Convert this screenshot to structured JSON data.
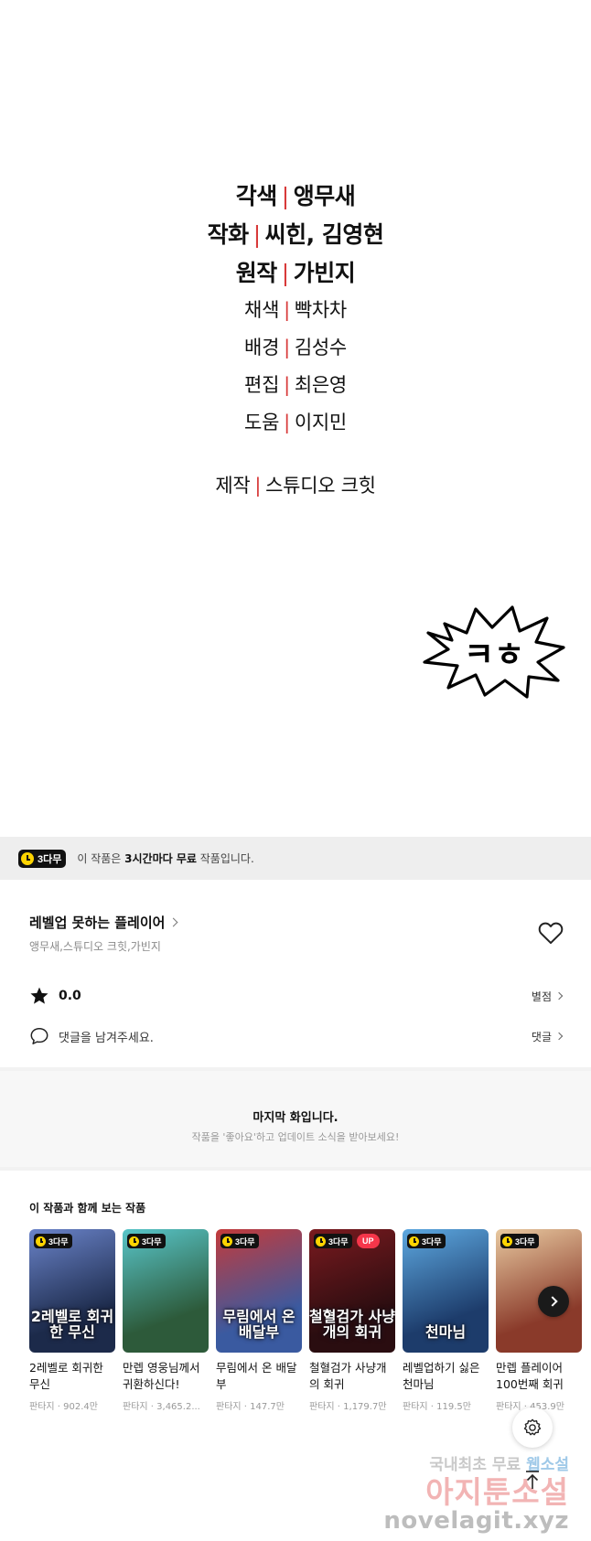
{
  "credits": {
    "lines": [
      {
        "role": "각색",
        "names": "앵무새"
      },
      {
        "role": "작화",
        "names": "씨힌, 김영현"
      },
      {
        "role": "원작",
        "names": "가빈지"
      },
      {
        "role": "채색",
        "names": "빡차차"
      },
      {
        "role": "배경",
        "names": "김성수"
      },
      {
        "role": "편집",
        "names": "최은영"
      },
      {
        "role": "도움",
        "names": "이지민"
      },
      {
        "role": "제작",
        "names": "스튜디오 크힛"
      }
    ],
    "separator": "|",
    "sfx_text": "ㅋㅎ"
  },
  "free_banner": {
    "badge": "3다무",
    "text_prefix": "이 작품은 ",
    "text_bold": "3시간마다 무료",
    "text_suffix": " 작품입니다."
  },
  "work": {
    "title": "레벨업 못하는 플레이어",
    "authors": "앵무새,스튜디오 크힛,가빈지",
    "rating": "0.0",
    "rating_link": "별점",
    "comment_prompt": "댓글을 남겨주세요.",
    "comment_link": "댓글"
  },
  "last_episode": {
    "title": "마지막 화입니다.",
    "subtitle": "작품을 '좋아요'하고 업데이트 소식을 받아보세요!"
  },
  "recommendations": {
    "heading": "이 작품과 함께 보는 작품",
    "items": [
      {
        "title": "2레벨로 회귀한 무신",
        "cover_text": "2레벨로 회귀한 무신",
        "genre": "판타지",
        "views": "902.4만",
        "badge": "3다무",
        "up": "",
        "colors": [
          "#1c2a4a",
          "#6a83c9"
        ]
      },
      {
        "title": "만렙 영웅님께서 귀환하신다!",
        "cover_text": "",
        "genre": "판타지",
        "views": "3,465.2...",
        "badge": "3다무",
        "up": "",
        "colors": [
          "#2d5a3a",
          "#58c5c9"
        ]
      },
      {
        "title": "무림에서 온 배달부",
        "cover_text": "무림에서 온 배달부",
        "genre": "판타지",
        "views": "147.7만",
        "badge": "3다무",
        "up": "",
        "colors": [
          "#3a5aa0",
          "#c43a3a"
        ]
      },
      {
        "title": "철혈검가 사냥개의 회귀",
        "cover_text": "철혈검가 사냥개의 회귀",
        "genre": "판타지",
        "views": "1,179.7만",
        "badge": "3다무",
        "up": "UP",
        "colors": [
          "#2a0d10",
          "#7a1a1f"
        ]
      },
      {
        "title": "레벨업하기 싫은 천마님",
        "cover_text": "천마님",
        "genre": "판타지",
        "views": "119.5만",
        "badge": "3다무",
        "up": "",
        "colors": [
          "#1d3c6b",
          "#5da8e0"
        ]
      },
      {
        "title": "만렙 플레이어 100번째 회귀",
        "cover_text": "",
        "genre": "판타지",
        "views": "453.9만",
        "badge": "3다무",
        "up": "",
        "colors": [
          "#8a3a2a",
          "#e8c9a0"
        ]
      }
    ]
  },
  "watermark": {
    "line1_a": "국내최초 무료 ",
    "line1_b": "웹소설",
    "line2": "아지툰소설",
    "line3": "novelagit.xyz"
  },
  "icons": {
    "heart": "heart-icon",
    "star": "star-icon",
    "comment": "comment-icon",
    "next": "chevron-right-icon",
    "settings": "gear-icon",
    "scroll_top": "arrow-up-icon"
  },
  "colors": {
    "separator": "#d83a3a",
    "badge_bg": "#111111",
    "badge_clock": "#ffd400",
    "up_badge": "#f5364a"
  }
}
